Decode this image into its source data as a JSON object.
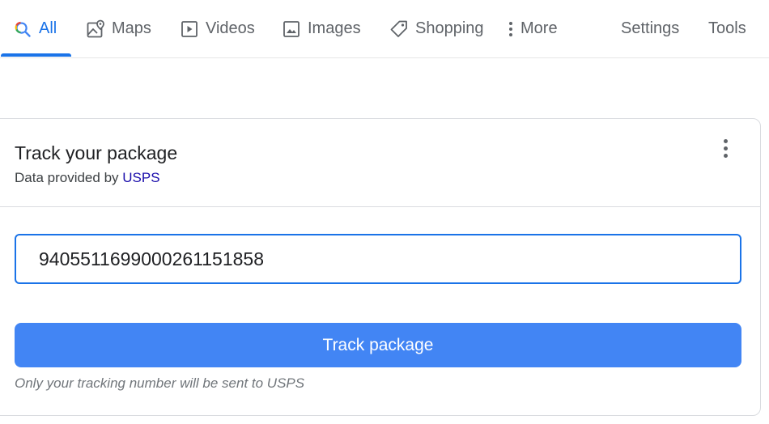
{
  "tabs": {
    "all": "All",
    "maps": "Maps",
    "videos": "Videos",
    "images": "Images",
    "shopping": "Shopping",
    "more": "More",
    "settings": "Settings",
    "tools": "Tools"
  },
  "card": {
    "title": "Track your package",
    "sub_prefix": "Data provided by",
    "provider": "USPS",
    "tracking_number": "9405511699000261151858",
    "button_label": "Track package",
    "note": "Only your tracking number will be sent to USPS"
  },
  "colors": {
    "accent": "#1a73e8",
    "button": "#4285f4",
    "link": "#1a0dab"
  },
  "icons": [
    "search-icon",
    "maps-icon",
    "videos-icon",
    "images-icon",
    "shopping-tag-icon",
    "more-vert-icon",
    "card-menu-icon"
  ]
}
